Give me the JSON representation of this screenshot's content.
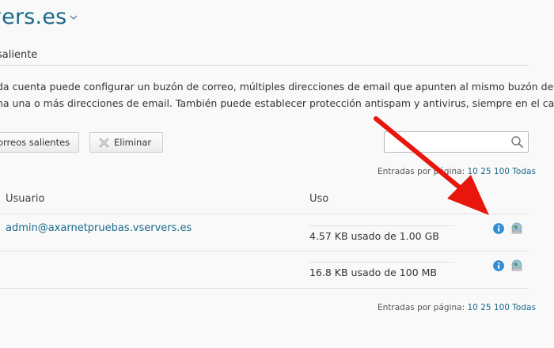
{
  "header": {
    "title": "vers.es",
    "section": "saliente"
  },
  "description": {
    "line1": "da cuenta puede configurar un buzón de correo, múltiples direcciones de email que apunten al mismo buzón de",
    "line2": "na una o más direcciones de email. También puede establecer protección antispam y antivirus, siempre en el caso"
  },
  "toolbar": {
    "outgoing_label": "orreos salientes",
    "delete_label": "Eliminar",
    "search_placeholder": ""
  },
  "paging": {
    "label": "Entradas por página:",
    "options": [
      "10",
      "25",
      "100",
      "Todas"
    ]
  },
  "table": {
    "columns": [
      "Usuario",
      "Uso"
    ],
    "rows": [
      {
        "user": "admin@axarnetpruebas.vservers.es",
        "usage": "4.57 KB usado de 1.00 GB"
      },
      {
        "user": "",
        "usage": "16.8 KB usado de 100 MB"
      }
    ]
  },
  "icons": {
    "row_info": "info-icon",
    "row_monitor": "monitor-icon",
    "annotation": "red-arrow"
  },
  "colors": {
    "link": "#1a6a8a",
    "info_blue": "#2f8fd8",
    "arrow_red": "#e8160c"
  }
}
